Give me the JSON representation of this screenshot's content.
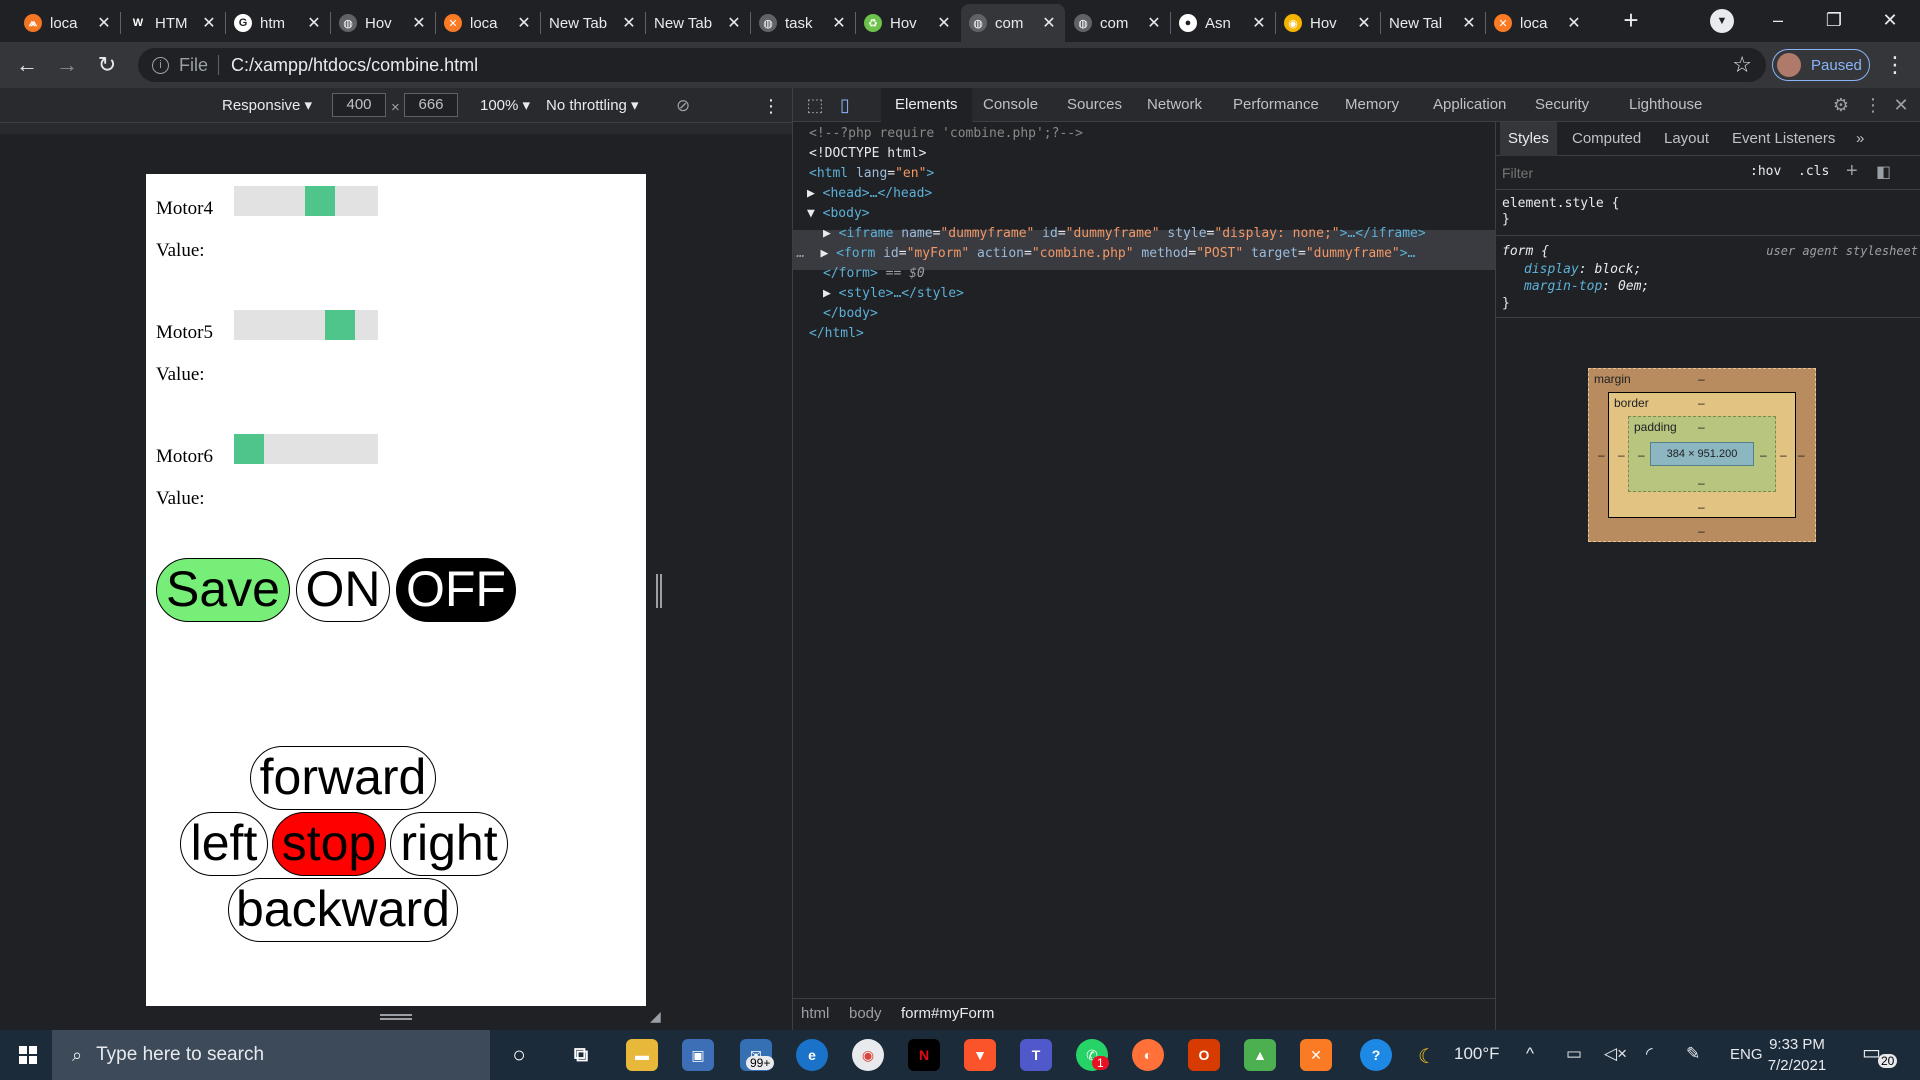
{
  "browser": {
    "tabs": [
      {
        "title": "loca",
        "icon": "xampp-icon",
        "color": "#f37623",
        "glyph": "⩕"
      },
      {
        "title": "HTM",
        "icon": "w3schools-icon",
        "color": "#202124",
        "glyph": "W"
      },
      {
        "title": "htm",
        "icon": "google-icon",
        "color": "#ffffff",
        "glyph": "G"
      },
      {
        "title": "Hov",
        "icon": "globe-icon",
        "color": "#5f6368",
        "glyph": "◍"
      },
      {
        "title": "loca",
        "icon": "xampp-icon",
        "color": "#fb7a24",
        "glyph": "✕"
      },
      {
        "title": "New Tab",
        "icon": "",
        "color": "",
        "glyph": ""
      },
      {
        "title": "New Tab",
        "icon": "",
        "color": "",
        "glyph": ""
      },
      {
        "title": "task",
        "icon": "globe-icon",
        "color": "#5f6368",
        "glyph": "◍"
      },
      {
        "title": "Hov",
        "icon": "nodejs-icon",
        "color": "#6cc24a",
        "glyph": "♻"
      },
      {
        "title": "com",
        "icon": "globe-icon",
        "color": "#5f6368",
        "glyph": "◍"
      },
      {
        "title": "com",
        "icon": "globe-icon",
        "color": "#5f6368",
        "glyph": "◍"
      },
      {
        "title": "Asn",
        "icon": "github-icon",
        "color": "#ffffff",
        "glyph": "●"
      },
      {
        "title": "Hov",
        "icon": "chrome-icon",
        "color": "#f5b400",
        "glyph": "◉"
      },
      {
        "title": "New Tal",
        "icon": "",
        "color": "",
        "glyph": ""
      },
      {
        "title": "loca",
        "icon": "xampp-icon",
        "color": "#fb7a24",
        "glyph": "✕"
      }
    ],
    "active_tab_index": 9,
    "url_scheme": "File",
    "url": "C:/xampp/htdocs/combine.html",
    "profile_status": "Paused"
  },
  "device_toolbar": {
    "mode": "Responsive",
    "width": "400",
    "height": "666",
    "times": "×",
    "zoom": "100%",
    "throttling": "No throttling"
  },
  "page": {
    "motors": [
      {
        "label": "Motor4",
        "value_label": "Value:",
        "level": 0.62
      },
      {
        "label": "Motor5",
        "value_label": "Value:",
        "level": 0.8
      },
      {
        "label": "Motor6",
        "value_label": "Value:",
        "level": 0.0
      }
    ],
    "buttons": {
      "save": "Save",
      "on": "ON",
      "off": "OFF",
      "forward": "forward",
      "left": "left",
      "stop": "stop",
      "right": "right",
      "backward": "backward"
    },
    "colors": {
      "slider_thumb": "#4fc58b",
      "save_bg": "#77ee77",
      "off_bg": "#000000",
      "stop_bg": "#ff0000"
    }
  },
  "devtools": {
    "tabs": [
      "Elements",
      "Console",
      "Sources",
      "Network",
      "Performance",
      "Memory",
      "Application",
      "Security",
      "Lighthouse"
    ],
    "active_tab": "Elements",
    "dom": {
      "line1": "<!--?php require 'combine.php';?-->",
      "line2": "<!DOCTYPE html>",
      "html_open": "<html",
      "html_attr": "lang",
      "html_val": "\"en\"",
      "head": "<head>…</head>",
      "body_open": "<body>",
      "iframe_tag": "<iframe",
      "iframe_a1": "name",
      "iframe_v1": "\"dummyframe\"",
      "iframe_a2": "id",
      "iframe_v2": "\"dummyframe\"",
      "iframe_a3": "style",
      "iframe_v3": "\"display: none;\"",
      "iframe_close": ">…</iframe>",
      "form_tag": "<form",
      "form_a1": "id",
      "form_v1": "\"myForm\"",
      "form_a2": "action",
      "form_v2": "\"combine.php\"",
      "form_a3": "method",
      "form_v3": "\"POST\"",
      "form_a4": "target",
      "form_v4": "\"dummyframe\"",
      "form_close_gt": ">…",
      "form_end": "</form>",
      "form_marker": "== $0",
      "style": "<style>…</style>",
      "body_close": "</body>",
      "html_close": "</html>"
    },
    "breadcrumbs": [
      "html",
      "body",
      "form#myForm"
    ],
    "styles_tabs": [
      "Styles",
      "Computed",
      "Layout",
      "Event Listeners"
    ],
    "filter_placeholder": "Filter",
    "hov": ":hov",
    "cls": ".cls",
    "rules": {
      "element_style_selector": "element.style {",
      "close_brace": "}",
      "form_selector": "form {",
      "form_origin": "user agent stylesheet",
      "prop1": "display",
      "val1": "block;",
      "prop2": "margin-top",
      "val2": "0em;"
    },
    "box_model": {
      "margin_label": "margin",
      "border_label": "border",
      "padding_label": "padding",
      "dash": "–",
      "content": "384 × 951.200"
    }
  },
  "taskbar": {
    "search_placeholder": "Type here to search",
    "mail_badge": "99+",
    "whatsapp_badge": "1",
    "temperature": "100°F",
    "language": "ENG",
    "time": "9:33 PM",
    "date": "7/2/2021",
    "notification_count": "20"
  }
}
